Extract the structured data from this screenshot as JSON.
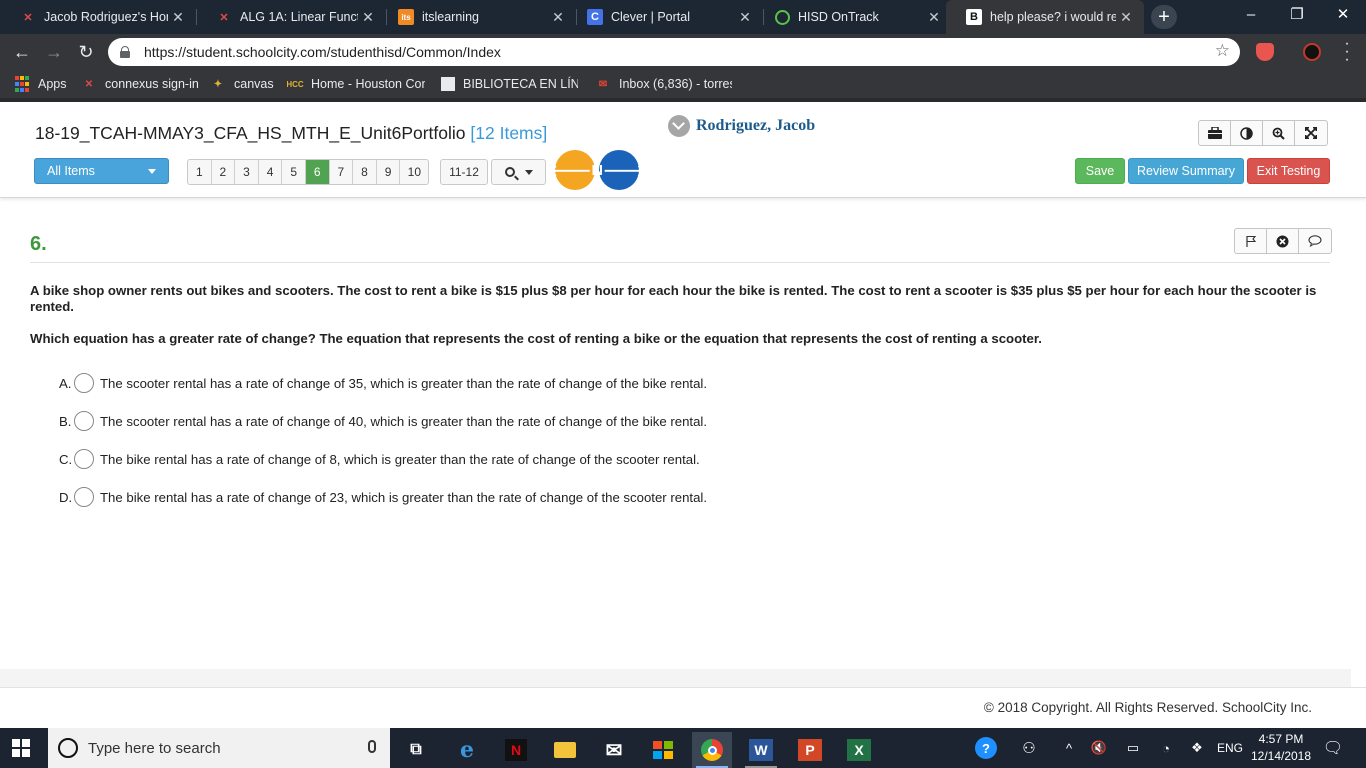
{
  "browser": {
    "tabs": [
      {
        "title": "Jacob Rodriguez's Hom",
        "icon": "connexus-x-icon",
        "icon_color": "#e04a4a"
      },
      {
        "title": "ALG 1A: Linear Function",
        "icon": "connexus-x-icon",
        "icon_color": "#e04a4a"
      },
      {
        "title": "itslearning",
        "icon": "itslearning-icon",
        "icon_color": "#f08a24"
      },
      {
        "title": "Clever | Portal",
        "icon": "clever-icon",
        "icon_color": "#4472e8"
      },
      {
        "title": "HISD OnTrack",
        "icon": "ontrack-icon",
        "icon_color": "#5bc24a"
      },
      {
        "title": "help please? i would re",
        "icon": "brainly-icon",
        "icon_color": "#111111"
      }
    ],
    "url": "https://student.schoolcity.com/studenthisd/Common/Index",
    "bookmarks": [
      {
        "label": "Apps",
        "icon": "apps-grid-icon"
      },
      {
        "label": "connexus sign-in",
        "icon": "connexus-x-icon"
      },
      {
        "label": "canvas",
        "icon": "canvas-icon"
      },
      {
        "label": "Home - Houston Con",
        "icon": "hcc-icon"
      },
      {
        "label": "BIBLIOTECA EN LÍNEA",
        "icon": "library-icon"
      },
      {
        "label": "Inbox (6,836) - torres",
        "icon": "gmail-icon"
      }
    ]
  },
  "header": {
    "test_name": "18-19_TCAH-MMAY3_CFA_HS_MTH_E_Unit6Portfolio",
    "item_count": "[12 Items]",
    "student_name": "Rodriguez, Jacob",
    "filter_label": "All Items",
    "pages": [
      "1",
      "2",
      "3",
      "4",
      "5",
      "6",
      "7",
      "8",
      "9",
      "10"
    ],
    "active_page": "6",
    "range_label": "11-12",
    "prev_label": "P",
    "next_label": "N",
    "save_label": "Save",
    "review_label": "Review Summary",
    "exit_label": "Exit Testing",
    "colors": {
      "save": "#5cb85c",
      "review": "#46a7d6",
      "exit": "#d9534f",
      "active_page": "#51a351",
      "prev": "#f4a522",
      "next": "#1b63b8"
    }
  },
  "question": {
    "number": "6.",
    "stem": "A bike shop owner rents out bikes and scooters.  The cost to rent a bike is $15 plus $8 per hour for each hour the bike is rented.  The cost to rent a scooter is $35 plus $5 per hour for each hour the scooter is rented.",
    "prompt": "Which equation has a greater rate of change?  The equation that represents the cost of renting a bike or the equation that represents the cost of renting a scooter.",
    "choices": [
      {
        "letter": "A.",
        "text": "The scooter rental has a rate of change of 35, which is greater than the rate of change of the bike rental."
      },
      {
        "letter": "B.",
        "text": "The scooter rental has a rate of change of 40, which is greater than the rate of change of the bike rental."
      },
      {
        "letter": "C.",
        "text": "The bike rental has a rate of change of 8, which is greater than the rate of change of the scooter rental."
      },
      {
        "letter": "D.",
        "text": "The bike rental has a rate of change of 23, which is greater than the rate of change of the scooter rental."
      }
    ]
  },
  "footer": {
    "copyright": "© 2018 Copyright. All Rights Reserved. SchoolCity Inc."
  },
  "taskbar": {
    "search_placeholder": "Type here to search",
    "language": "ENG",
    "time": "4:57 PM",
    "date": "12/14/2018"
  }
}
